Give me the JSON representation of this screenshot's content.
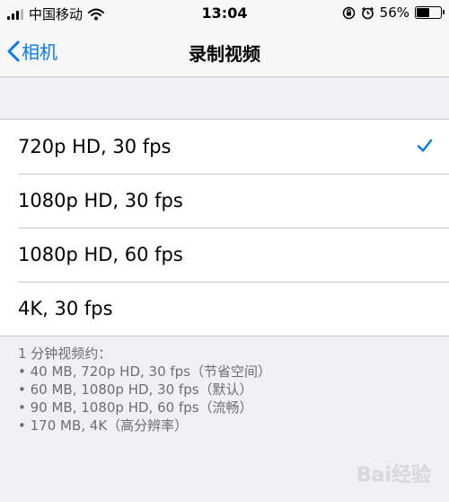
{
  "status_bar": {
    "carrier": "中国移动",
    "time": "13:04",
    "battery_percent": "56%",
    "battery_level": 0.56,
    "icons": [
      "signal-icon",
      "wifi-icon",
      "orientation-lock-icon",
      "alarm-icon",
      "battery-icon"
    ]
  },
  "nav": {
    "back_label": "相机",
    "title": "录制视频"
  },
  "options": [
    {
      "label": "720p HD, 30 fps",
      "selected": true
    },
    {
      "label": "1080p HD, 30 fps",
      "selected": false
    },
    {
      "label": "1080p HD, 60 fps",
      "selected": false
    },
    {
      "label": "4K, 30 fps",
      "selected": false
    }
  ],
  "footer": {
    "heading": "1 分钟视频约：",
    "lines": [
      "• 40 MB, 720p HD, 30 fps（节省空间）",
      "• 60 MB, 1080p HD, 30 fps（默认）",
      "• 90 MB, 1080p HD, 60 fps（流畅）",
      "• 170 MB, 4K（高分辨率）"
    ]
  },
  "watermark": "Bai经验",
  "colors": {
    "accent": "#007aff",
    "background": "#efeff4",
    "footer_text": "#6d6d72"
  }
}
